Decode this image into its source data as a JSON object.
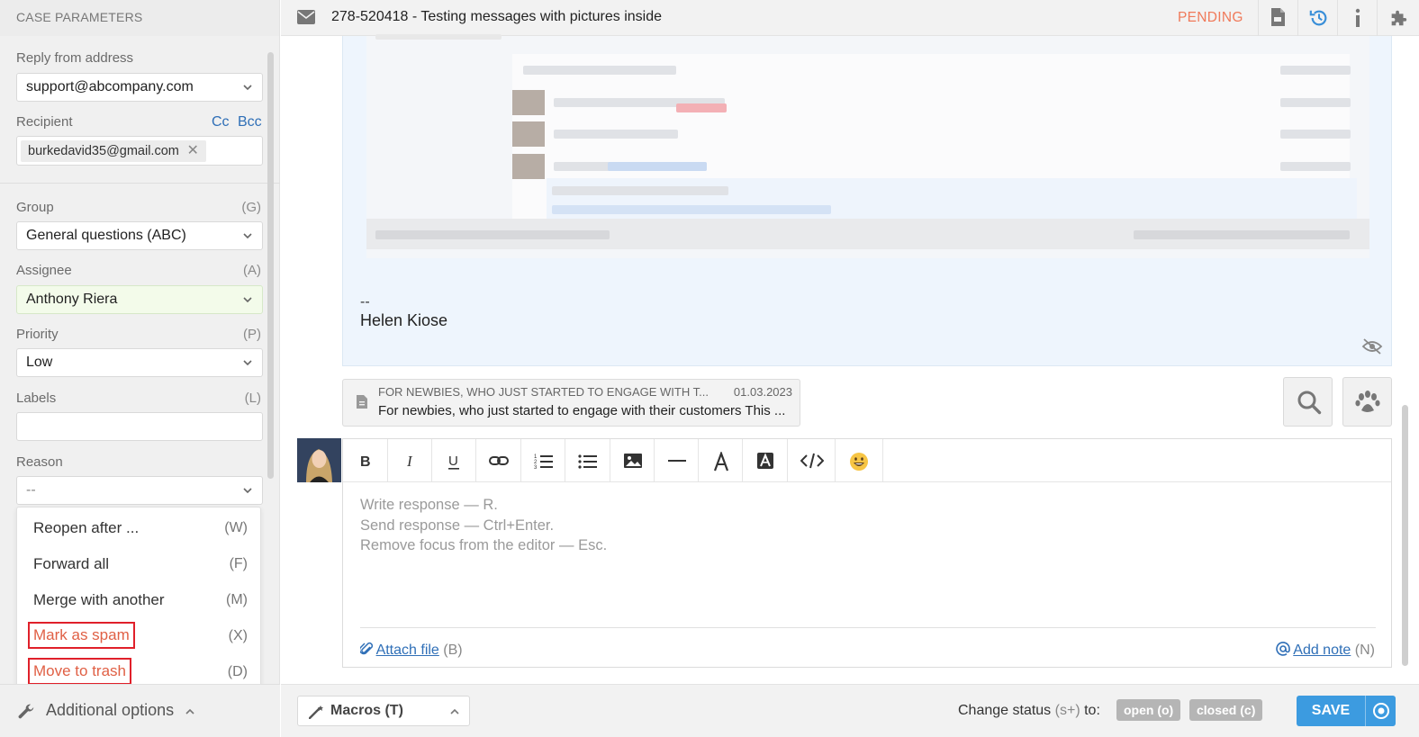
{
  "sidebar": {
    "header": "CASE PARAMETERS",
    "reply_from_label": "Reply from address",
    "reply_from_value": "support@abcompany.com",
    "recipient_label": "Recipient",
    "cc": "Cc",
    "bcc": "Bcc",
    "recipient_chip": "burkedavid35@gmail.com",
    "group_label": "Group",
    "group_hotkey": "(G)",
    "group_value": "General questions (ABC)",
    "assignee_label": "Assignee",
    "assignee_hotkey": "(A)",
    "assignee_value": "Anthony Riera",
    "priority_label": "Priority",
    "priority_hotkey": "(P)",
    "priority_value": "Low",
    "labels_label": "Labels",
    "labels_hotkey": "(L)",
    "reason_label": "Reason",
    "reason_value": "--",
    "menu": [
      {
        "label": "Reopen after ...",
        "hotkey": "(W)"
      },
      {
        "label": "Forward all",
        "hotkey": "(F)"
      },
      {
        "label": "Merge with another",
        "hotkey": "(M)"
      },
      {
        "label": "Mark as spam",
        "hotkey": "(X)"
      },
      {
        "label": "Move to trash",
        "hotkey": "(D)"
      }
    ],
    "additional_options": "Additional options"
  },
  "topbar": {
    "title": "278-520418 - Testing messages with pictures inside",
    "status": "PENDING"
  },
  "message": {
    "sig_dash": "--",
    "sig_name": "Helen Kiose"
  },
  "template": {
    "title": "FOR NEWBIES, WHO JUST STARTED TO ENGAGE WITH T...",
    "date": "01.03.2023",
    "preview": "For newbies, who just started to engage with their customers This ..."
  },
  "editor": {
    "placeholder_lines": [
      "Write response — R.",
      "Send response — Ctrl+Enter.",
      "Remove focus from the editor — Esc."
    ],
    "attach_label": "Attach file",
    "attach_hotkey": "(B)",
    "note_label": "Add note",
    "note_hotkey": "(N)"
  },
  "bottom": {
    "macros": "Macros (T)",
    "change_status": "Change status",
    "change_status_hotkey": "(s+)",
    "change_status_to": "to:",
    "open_pill": "open (o)",
    "closed_pill": "closed (c)",
    "save": "SAVE"
  },
  "colors": {
    "accent": "#3c9be0",
    "pending": "#f07a5a",
    "danger_border": "#e0202a",
    "link": "#2f6fb7"
  }
}
